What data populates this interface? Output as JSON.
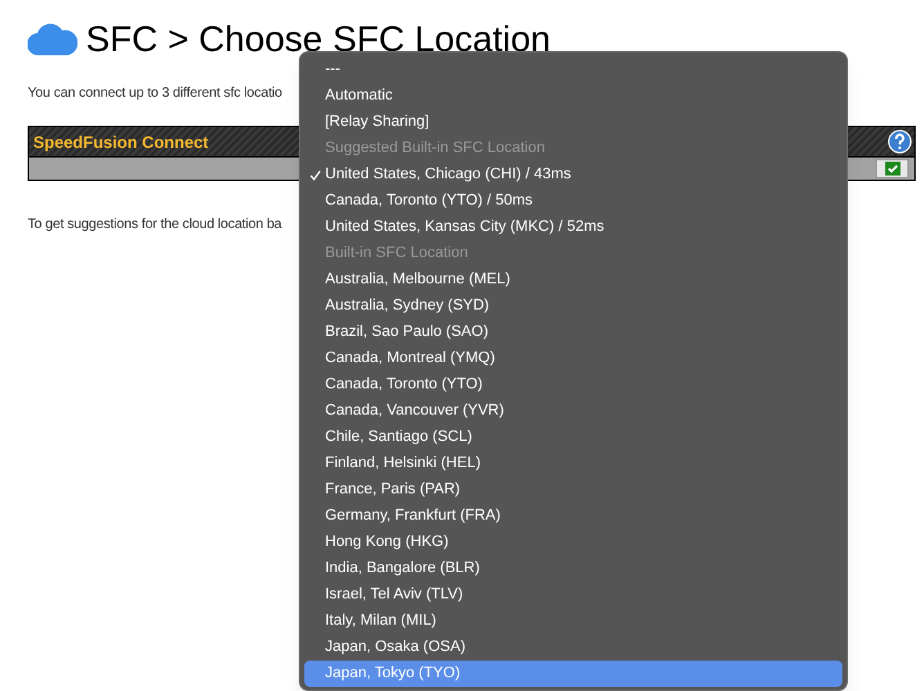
{
  "page": {
    "title": "SFC > Choose SFC Location",
    "intro": "You can connect up to 3 different sfc locatio",
    "hint": "To get suggestions for the cloud location ba"
  },
  "table": {
    "header": "SpeedFusion Connect"
  },
  "dropdown": {
    "items": [
      {
        "label": "---",
        "kind": "option",
        "checked": false,
        "selected": false
      },
      {
        "label": "Automatic",
        "kind": "option",
        "checked": false,
        "selected": false
      },
      {
        "label": "[Relay Sharing]",
        "kind": "option",
        "checked": false,
        "selected": false
      },
      {
        "label": "Suggested Built-in SFC Location",
        "kind": "header"
      },
      {
        "label": "United States, Chicago (CHI) / 43ms",
        "kind": "option",
        "checked": true,
        "selected": false
      },
      {
        "label": "Canada, Toronto (YTO) / 50ms",
        "kind": "option",
        "checked": false,
        "selected": false
      },
      {
        "label": "United States, Kansas City (MKC) / 52ms",
        "kind": "option",
        "checked": false,
        "selected": false
      },
      {
        "label": "Built-in SFC Location",
        "kind": "header"
      },
      {
        "label": "Australia, Melbourne (MEL)",
        "kind": "option",
        "checked": false,
        "selected": false
      },
      {
        "label": "Australia, Sydney (SYD)",
        "kind": "option",
        "checked": false,
        "selected": false
      },
      {
        "label": "Brazil, Sao Paulo (SAO)",
        "kind": "option",
        "checked": false,
        "selected": false
      },
      {
        "label": "Canada, Montreal (YMQ)",
        "kind": "option",
        "checked": false,
        "selected": false
      },
      {
        "label": "Canada, Toronto (YTO)",
        "kind": "option",
        "checked": false,
        "selected": false
      },
      {
        "label": "Canada, Vancouver (YVR)",
        "kind": "option",
        "checked": false,
        "selected": false
      },
      {
        "label": "Chile, Santiago (SCL)",
        "kind": "option",
        "checked": false,
        "selected": false
      },
      {
        "label": "Finland, Helsinki (HEL)",
        "kind": "option",
        "checked": false,
        "selected": false
      },
      {
        "label": "France, Paris (PAR)",
        "kind": "option",
        "checked": false,
        "selected": false
      },
      {
        "label": "Germany, Frankfurt (FRA)",
        "kind": "option",
        "checked": false,
        "selected": false
      },
      {
        "label": "Hong Kong (HKG)",
        "kind": "option",
        "checked": false,
        "selected": false
      },
      {
        "label": "India, Bangalore (BLR)",
        "kind": "option",
        "checked": false,
        "selected": false
      },
      {
        "label": "Israel, Tel Aviv (TLV)",
        "kind": "option",
        "checked": false,
        "selected": false
      },
      {
        "label": "Italy, Milan (MIL)",
        "kind": "option",
        "checked": false,
        "selected": false
      },
      {
        "label": "Japan, Osaka (OSA)",
        "kind": "option",
        "checked": false,
        "selected": false
      },
      {
        "label": "Japan, Tokyo (TYO)",
        "kind": "option",
        "checked": false,
        "selected": true
      }
    ]
  }
}
